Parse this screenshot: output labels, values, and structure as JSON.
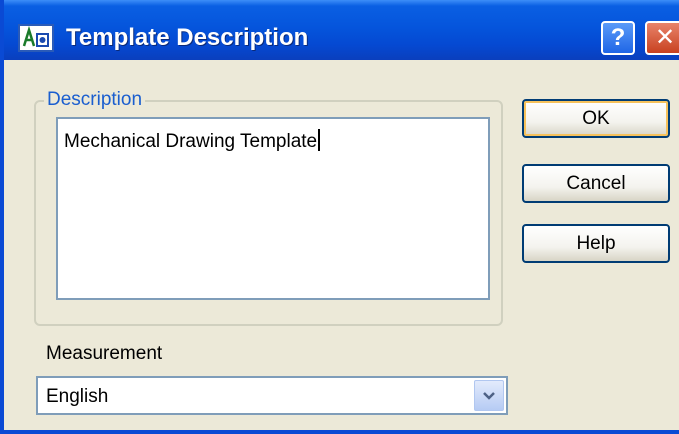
{
  "titlebar": {
    "title": "Template Description",
    "help_button": "?",
    "close_button": "✕"
  },
  "description": {
    "legend": "Description",
    "value": "Mechanical Drawing Template"
  },
  "buttons": {
    "ok": "OK",
    "cancel": "Cancel",
    "help": "Help"
  },
  "measurement": {
    "label": "Measurement",
    "selected": "English"
  }
}
